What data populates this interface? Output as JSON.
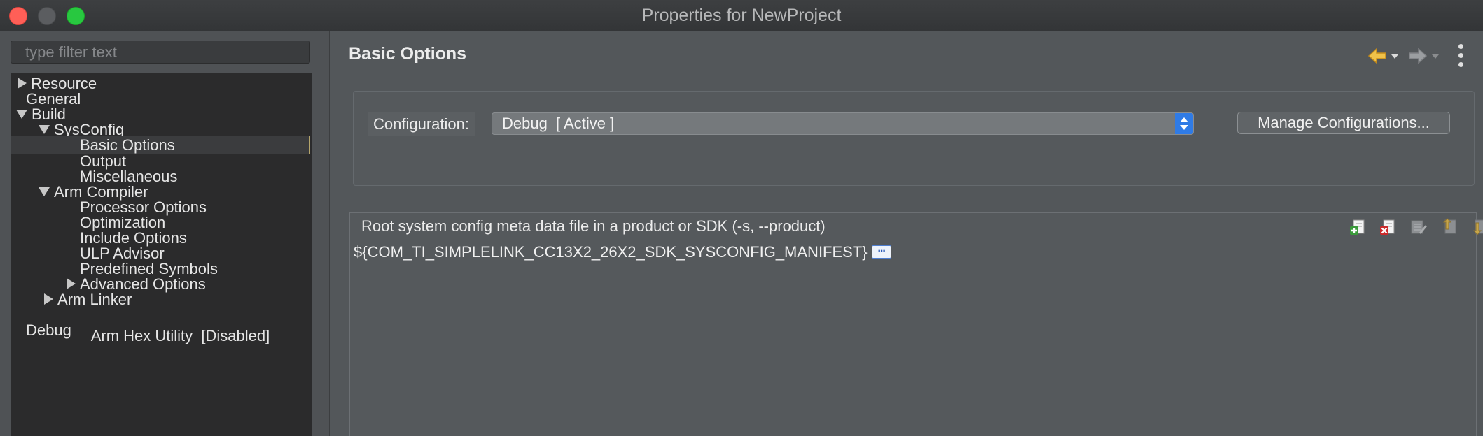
{
  "window": {
    "title": "Properties for NewProject"
  },
  "sidebar": {
    "filter_placeholder": "type filter text",
    "tree": [
      {
        "label": "Resource",
        "expander": "collapsed",
        "level": 0
      },
      {
        "label": "General",
        "expander": "none",
        "level": 0
      },
      {
        "label": "Build",
        "expander": "expanded",
        "level": 0
      },
      {
        "label": "SysConfig",
        "expander": "expanded",
        "level": 1
      },
      {
        "label": "Basic Options",
        "expander": "none",
        "level": 2,
        "selected": true
      },
      {
        "label": "Output",
        "expander": "none",
        "level": 2
      },
      {
        "label": "Miscellaneous",
        "expander": "none",
        "level": 2
      },
      {
        "label": "Arm Compiler",
        "expander": "expanded",
        "level": 1
      },
      {
        "label": "Processor Options",
        "expander": "none",
        "level": 2
      },
      {
        "label": "Optimization",
        "expander": "none",
        "level": 2
      },
      {
        "label": "Include Options",
        "expander": "none",
        "level": 2
      },
      {
        "label": "ULP Advisor",
        "expander": "none",
        "level": 2
      },
      {
        "label": "Predefined Symbols",
        "expander": "none",
        "level": 2
      },
      {
        "label": "Advanced Options",
        "expander": "collapsed",
        "level": 2
      },
      {
        "label": "Arm Linker",
        "expander": "collapsed",
        "level": 1
      },
      {
        "label": "Arm Hex Utility  [Disabled]",
        "expander": "none",
        "level": 1
      },
      {
        "label": "Debug",
        "expander": "none",
        "level": 0
      }
    ]
  },
  "main": {
    "page_title": "Basic Options",
    "nav": {
      "back_icon": "arrow-left-icon",
      "forward_icon": "arrow-right-icon",
      "menu_icon": "vertical-ellipsis-icon"
    },
    "configuration": {
      "label": "Configuration:",
      "selected_value": "Debug  [ Active ]",
      "manage_button_label": "Manage Configurations..."
    },
    "product": {
      "label": "Root system config meta data file in a product or SDK (-s, --product)",
      "value": "${COM_TI_SIMPLELINK_CC13X2_26X2_SDK_SYSCONFIG_MANIFEST}",
      "list_tools": [
        "add-icon",
        "delete-icon",
        "edit-icon",
        "move-up-icon",
        "move-down-icon"
      ]
    }
  },
  "colors": {
    "accent_blue": "#2f7be6",
    "selection_border": "#b5a56b",
    "back_arrow": "#e8b44a",
    "close_button": "#ff5f57",
    "zoom_button": "#28c840"
  }
}
